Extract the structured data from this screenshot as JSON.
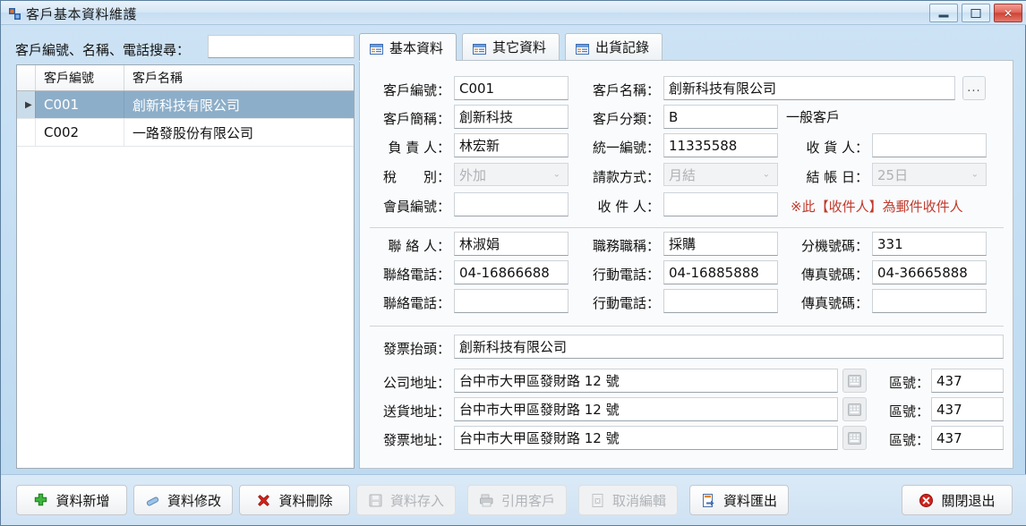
{
  "window": {
    "title": "客戶基本資料維護",
    "minimize_label": "最小化",
    "maximize_label": "還原",
    "close_label": "關閉"
  },
  "search": {
    "label": "客戶編號、名稱、電話搜尋：",
    "value": "",
    "placeholder": ""
  },
  "grid": {
    "columns": [
      "",
      "客戶編號",
      "客戶名稱"
    ],
    "rows": [
      {
        "marker": "▶",
        "id": "C001",
        "name": "創新科技有限公司",
        "selected": true
      },
      {
        "marker": "",
        "id": "C002",
        "name": "一路發股份有限公司",
        "selected": false
      }
    ]
  },
  "tabs": [
    {
      "label": "基本資料",
      "icon": "table-icon",
      "active": true
    },
    {
      "label": "其它資料",
      "icon": "table-icon",
      "active": false
    },
    {
      "label": "出貨記錄",
      "icon": "table-icon",
      "active": false
    }
  ],
  "form": {
    "customer_id": {
      "label": "客戶編號：",
      "value": "C001"
    },
    "customer_name": {
      "label": "客戶名稱：",
      "value": "創新科技有限公司"
    },
    "browse_button": "...",
    "short_name": {
      "label": "客戶簡稱：",
      "value": "創新科技"
    },
    "category": {
      "label": "客戶分類：",
      "value": "B",
      "description": "一般客戶"
    },
    "principal": {
      "label": "負 責 人：",
      "value": "林宏新"
    },
    "tax_id": {
      "label": "統一編號：",
      "value": "11335588"
    },
    "receiver": {
      "label": "收 貨 人：",
      "value": ""
    },
    "tax_type": {
      "label": "稅　　別：",
      "value": "外加"
    },
    "payment_method": {
      "label": "請款方式：",
      "value": "月結"
    },
    "settle_day": {
      "label": "結 帳 日：",
      "value": "25日"
    },
    "member_id": {
      "label": "會員編號：",
      "value": ""
    },
    "recipient": {
      "label": "收 件 人：",
      "value": ""
    },
    "recipient_hint": "※此【收件人】為郵件收件人",
    "contact_name": {
      "label": "聯 絡 人：",
      "value": "林淑娟"
    },
    "job_title": {
      "label": "職務職稱：",
      "value": "採購"
    },
    "extension": {
      "label": "分機號碼：",
      "value": "331"
    },
    "phone1": {
      "label": "聯絡電話：",
      "value": "04-16866688"
    },
    "mobile1": {
      "label": "行動電話：",
      "value": "04-16885888"
    },
    "fax1": {
      "label": "傳真號碼：",
      "value": "04-36665888"
    },
    "phone2": {
      "label": "聯絡電話：",
      "value": ""
    },
    "mobile2": {
      "label": "行動電話：",
      "value": ""
    },
    "fax2": {
      "label": "傳真號碼：",
      "value": ""
    },
    "invoice_title": {
      "label": "發票抬頭：",
      "value": "創新科技有限公司"
    },
    "company_address": {
      "label": "公司地址：",
      "value": "台中市大甲區發財路 12 號",
      "zip_label": "區號：",
      "zip": "437"
    },
    "delivery_address": {
      "label": "送貨地址：",
      "value": "台中市大甲區發財路 12 號",
      "zip_label": "區號：",
      "zip": "437"
    },
    "invoice_address": {
      "label": "發票地址：",
      "value": "台中市大甲區發財路 12 號",
      "zip_label": "區號：",
      "zip": "437"
    }
  },
  "buttons": {
    "add": {
      "label": "資料新增",
      "icon": "plus-icon",
      "enabled": true
    },
    "edit": {
      "label": "資料修改",
      "icon": "pencil-icon",
      "enabled": true
    },
    "delete": {
      "label": "資料刪除",
      "icon": "x-mark-icon",
      "enabled": true
    },
    "save": {
      "label": "資料存入",
      "icon": "floppy-disk-icon",
      "enabled": false
    },
    "quote": {
      "label": "引用客戶",
      "icon": "copy-icon",
      "enabled": false
    },
    "cancel": {
      "label": "取消編輯",
      "icon": "cancel-icon",
      "enabled": false
    },
    "export": {
      "label": "資料匯出",
      "icon": "export-icon",
      "enabled": true
    },
    "exit": {
      "label": "關閉退出",
      "icon": "close-circle-icon",
      "enabled": true
    }
  },
  "colors": {
    "accent": "#8daec9",
    "warning": "#c0392b",
    "title_bar": "#d6e7f6",
    "panel": "#fafbfc"
  }
}
